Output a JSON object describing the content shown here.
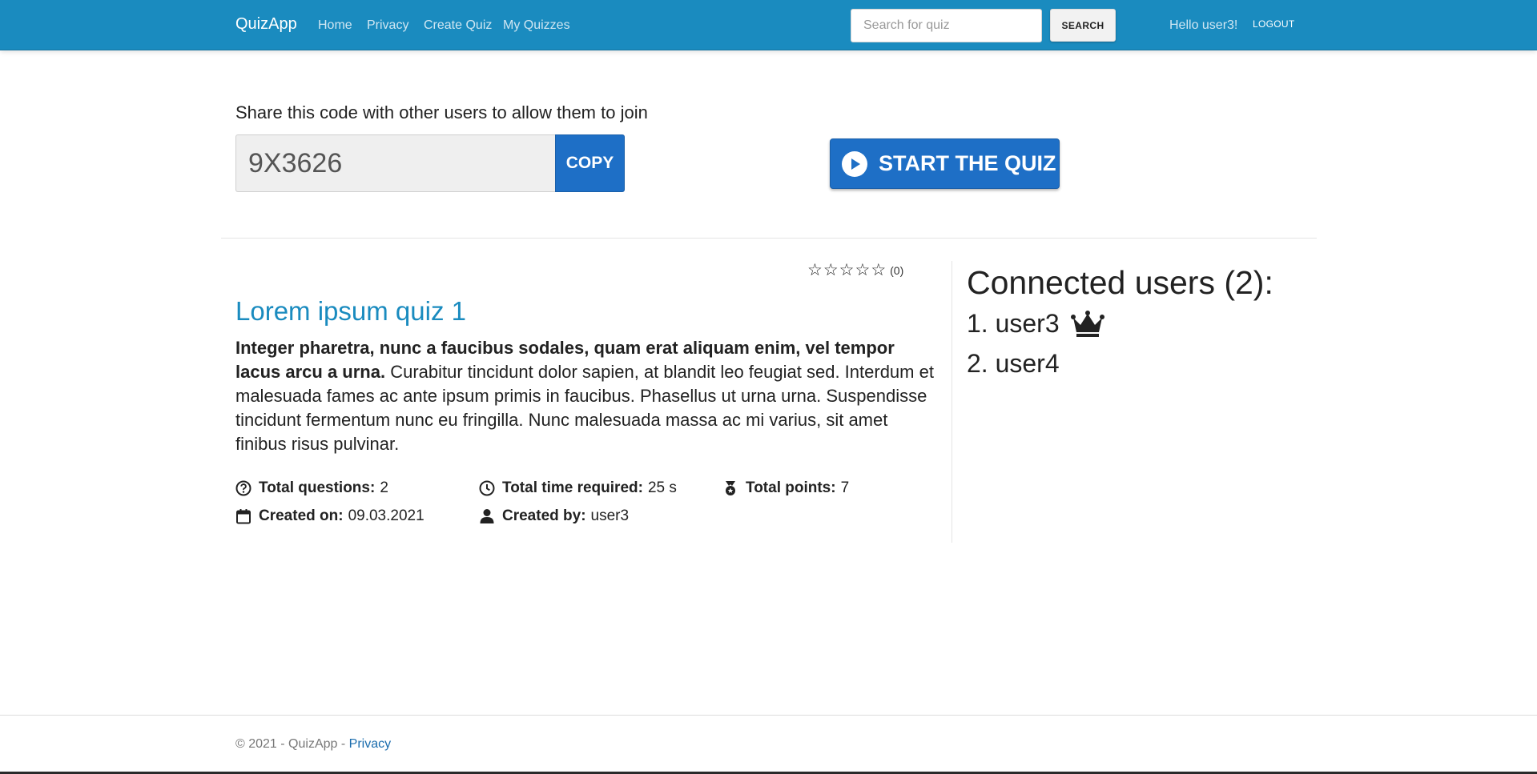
{
  "nav": {
    "brand": "QuizApp",
    "links": [
      "Home",
      "Privacy",
      "Create Quiz",
      "My Quizzes"
    ],
    "search_placeholder": "Search for quiz",
    "search_button": "SEARCH",
    "greeting": "Hello user3!",
    "logout": "LOGOUT"
  },
  "share": {
    "label": "Share this code with other users to allow them to join",
    "code": "9X3626",
    "copy_button": "COPY",
    "start_button": "START THE QUIZ"
  },
  "quiz": {
    "rating_count": "(0)",
    "rating_value": 0,
    "rating_max": 5,
    "title": "Lorem ipsum quiz 1",
    "description_bold": "Integer pharetra, nunc a faucibus sodales, quam erat aliquam enim, vel tempor lacus arcu a urna.",
    "description_rest": " Curabitur tincidunt dolor sapien, at blandit leo feugiat sed. Interdum et malesuada fames ac ante ipsum primis in faucibus. Phasellus ut urna urna. Suspendisse tincidunt fermentum nunc eu fringilla. Nunc malesuada massa ac mi varius, sit amet finibus risus pulvinar.",
    "total_questions_label": "Total questions:",
    "total_questions": "2",
    "total_time_label": "Total time required:",
    "total_time": "25 s",
    "total_points_label": "Total points:",
    "total_points": "7",
    "created_on_label": "Created on:",
    "created_on": "09.03.2021",
    "created_by_label": "Created by:",
    "created_by": "user3"
  },
  "connected": {
    "title": "Connected users (2):",
    "users": [
      "1. user3",
      "2. user4"
    ]
  },
  "footer": {
    "text": "© 2021 - QuizApp - ",
    "privacy": "Privacy"
  },
  "colors": {
    "navbar": "#1a8bbf",
    "primary_button": "#1e6fc6",
    "title_link": "#1a8bbf"
  },
  "icons": {
    "start": "play-circle-icon",
    "rating": "star-outline-icon",
    "questions": "question-circle-icon",
    "time": "clock-icon",
    "points": "medal-icon",
    "created_on": "calendar-icon",
    "created_by": "user-icon",
    "owner": "crown-icon"
  }
}
